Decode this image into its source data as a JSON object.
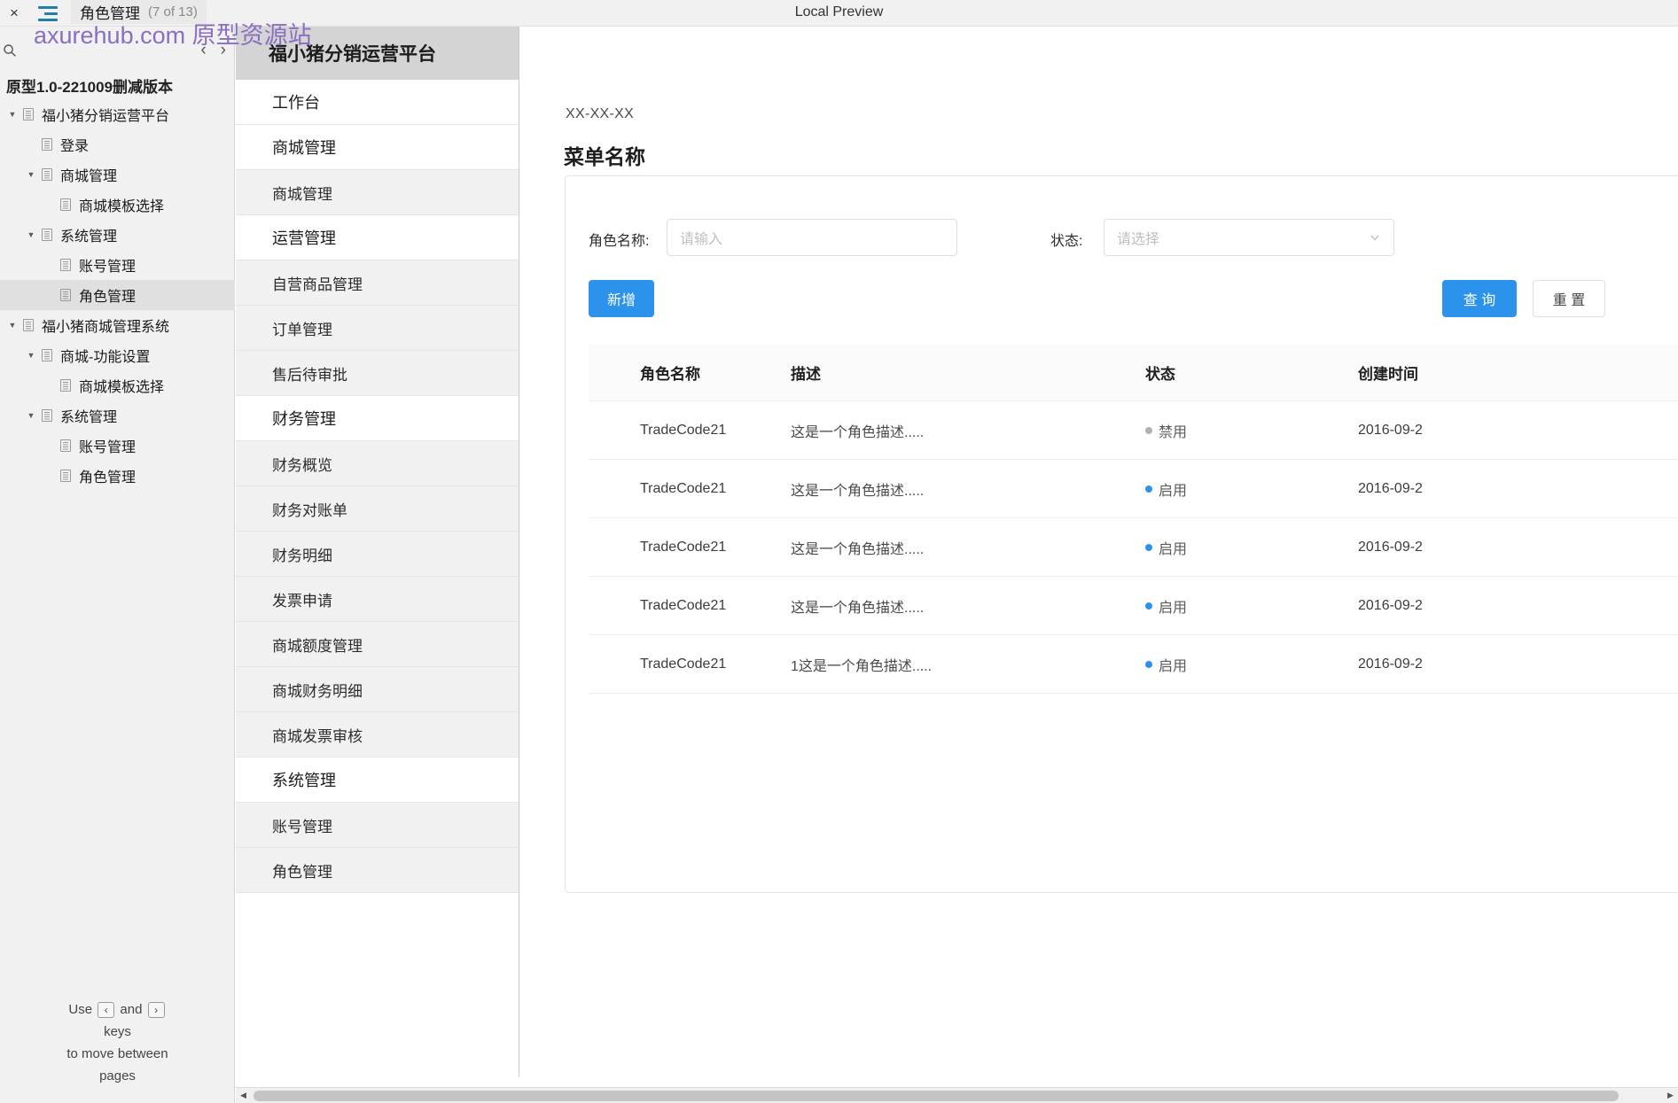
{
  "window": {
    "close_label": "×",
    "tab_title": "角色管理",
    "tab_count": "(7 of 13)",
    "preview_label": "Local Preview",
    "watermark": "axurehub.com 原型资源站"
  },
  "left_panel": {
    "search_placeholder": "",
    "prev_arrow": "‹",
    "next_arrow": "›",
    "prototype_title": "原型1.0-221009删减版本",
    "tree": [
      {
        "label": "福小猪分销运营平台",
        "level": 0,
        "twisty": "▼",
        "selected": false
      },
      {
        "label": "登录",
        "level": 1,
        "twisty": "",
        "selected": false
      },
      {
        "label": "商城管理",
        "level": 1,
        "twisty": "▼",
        "selected": false
      },
      {
        "label": "商城模板选择",
        "level": 2,
        "twisty": "",
        "selected": false
      },
      {
        "label": "系统管理",
        "level": 1,
        "twisty": "▼",
        "selected": false
      },
      {
        "label": "账号管理",
        "level": 2,
        "twisty": "",
        "selected": false
      },
      {
        "label": "角色管理",
        "level": 2,
        "twisty": "",
        "selected": true
      },
      {
        "label": "福小猪商城管理系统",
        "level": 0,
        "twisty": "▼",
        "selected": false
      },
      {
        "label": "商城-功能设置",
        "level": 1,
        "twisty": "▼",
        "selected": false
      },
      {
        "label": "商城模板选择",
        "level": 2,
        "twisty": "",
        "selected": false
      },
      {
        "label": "系统管理",
        "level": 1,
        "twisty": "▼",
        "selected": false
      },
      {
        "label": "账号管理",
        "level": 2,
        "twisty": "",
        "selected": false
      },
      {
        "label": "角色管理",
        "level": 2,
        "twisty": "",
        "selected": false
      }
    ],
    "hint_line1_pre": "Use",
    "hint_key_prev": "‹",
    "hint_line1_mid": "and",
    "hint_key_next": "›",
    "hint_line2": "keys",
    "hint_line3": "to move between",
    "hint_line4": "pages"
  },
  "nav": {
    "header": "福小猪分销运营平台",
    "items": [
      {
        "label": "工作台",
        "alt": false,
        "group": true
      },
      {
        "label": "商城管理",
        "alt": false,
        "group": true
      },
      {
        "label": "商城管理",
        "alt": true,
        "group": false
      },
      {
        "label": "运营管理",
        "alt": false,
        "group": true
      },
      {
        "label": "自营商品管理",
        "alt": true,
        "group": false
      },
      {
        "label": "订单管理",
        "alt": true,
        "group": false
      },
      {
        "label": "售后待审批",
        "alt": true,
        "group": false
      },
      {
        "label": "财务管理",
        "alt": false,
        "group": true
      },
      {
        "label": "财务概览",
        "alt": true,
        "group": false
      },
      {
        "label": "财务对账单",
        "alt": true,
        "group": false
      },
      {
        "label": "财务明细",
        "alt": true,
        "group": false
      },
      {
        "label": "发票申请",
        "alt": true,
        "group": false
      },
      {
        "label": "商城额度管理",
        "alt": true,
        "group": false
      },
      {
        "label": "商城财务明细",
        "alt": true,
        "group": false
      },
      {
        "label": "商城发票审核",
        "alt": true,
        "group": false
      },
      {
        "label": "系统管理",
        "alt": false,
        "group": true
      },
      {
        "label": "账号管理",
        "alt": true,
        "group": false
      },
      {
        "label": "角色管理",
        "alt": true,
        "group": false
      }
    ]
  },
  "main": {
    "breadcrumb": "XX-XX-XX",
    "page_title": "菜单名称",
    "filters": {
      "role_name_label": "角色名称:",
      "role_name_placeholder": "请输入",
      "role_name_value": "",
      "status_label": "状态:",
      "status_placeholder": "请选择",
      "status_value": ""
    },
    "buttons": {
      "add": "新增",
      "query": "查 询",
      "reset": "重 置"
    },
    "table": {
      "columns": [
        "角色名称",
        "描述",
        "状态",
        "创建时间"
      ],
      "rows": [
        {
          "name": "TradeCode21",
          "desc": "这是一个角色描述.....",
          "status": "禁用",
          "status_color": "#b0b0b0",
          "time": "2016-09-2"
        },
        {
          "name": "TradeCode21",
          "desc": "这是一个角色描述.....",
          "status": "启用",
          "status_color": "#2c93ec",
          "time": "2016-09-2"
        },
        {
          "name": "TradeCode21",
          "desc": "这是一个角色描述.....",
          "status": "启用",
          "status_color": "#2c93ec",
          "time": "2016-09-2"
        },
        {
          "name": "TradeCode21",
          "desc": "这是一个角色描述.....",
          "status": "启用",
          "status_color": "#2c93ec",
          "time": "2016-09-2"
        },
        {
          "name": "TradeCode21",
          "desc": "1这是一个角色描述.....",
          "status": "启用",
          "status_color": "#2c93ec",
          "time": "2016-09-2"
        }
      ]
    }
  },
  "scrollbar": {
    "left_arrow": "◀",
    "right_arrow": "▶"
  },
  "colors": {
    "accent": "#2c93ec",
    "disabled_dot": "#b0b0b0",
    "watermark": "#8a6fc0"
  }
}
